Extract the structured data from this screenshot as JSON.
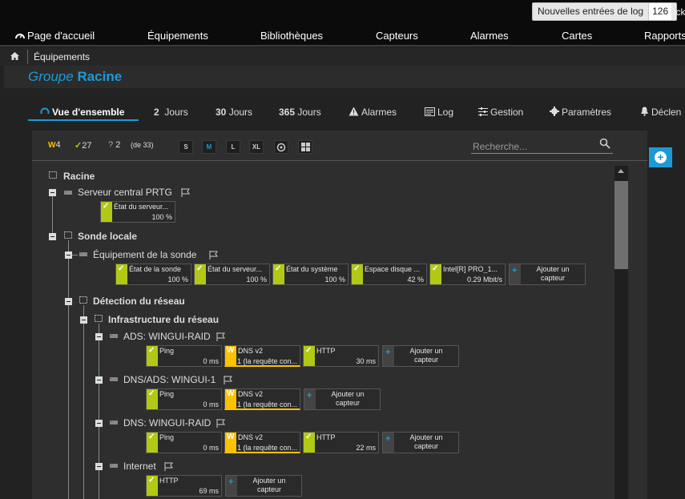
{
  "topbar": {
    "log_label": "Nouvelles entrées de log",
    "log_count": "126",
    "ticket_label": "Tick"
  },
  "nav": [
    "Page d'accueil",
    "Équipements",
    "Bibliothèques",
    "Capteurs",
    "Alarmes",
    "Cartes",
    "Rapports"
  ],
  "breadcrumb": {
    "current": "Équipements"
  },
  "page": {
    "title_prefix": "Groupe",
    "title_name": "Racine"
  },
  "tabs": {
    "overview": "Vue d'ensemble",
    "t2_num": "2",
    "t2_lbl": "Jours",
    "t30_num": "30",
    "t30_lbl": "Jours",
    "t365_num": "365",
    "t365_lbl": "Jours",
    "alarms": "Alarmes",
    "log": "Log",
    "manage": "Gestion",
    "settings": "Paramètres",
    "triggers": "Déclen"
  },
  "toolbar": {
    "warn_count": "4",
    "ok_count": "27",
    "unknown_count": "2",
    "total": "(de 33)",
    "sizes": [
      "S",
      "M",
      "L",
      "XL"
    ],
    "active_size": "M",
    "search_placeholder": "Recherche..."
  },
  "tree": {
    "root": "Racine",
    "server": "Serveur central PRTG",
    "local_probe": "Sonde locale",
    "probe_device": "Équipement de la sonde",
    "network_discovery": "Détection du réseau",
    "infrastructure": "Infrastructure du réseau",
    "ads": "ADS: WINGUI-RAID",
    "dnsads": "DNS/ADS: WINGUI-1",
    "dns": "DNS: WINGUI-RAID",
    "internet": "Internet"
  },
  "sensors": {
    "server": [
      {
        "name": "État du serveur...",
        "value": "100 %",
        "status": "ok"
      }
    ],
    "probe": [
      {
        "name": "État de la sonde",
        "value": "100 %",
        "status": "ok"
      },
      {
        "name": "État du serveur...",
        "value": "100 %",
        "status": "ok"
      },
      {
        "name": "État du système",
        "value": "100 %",
        "status": "ok"
      },
      {
        "name": "Espace disque ...",
        "value": "42 %",
        "status": "ok"
      },
      {
        "name": "Intel[R] PRO_1...",
        "value": "0.29 Mbit/s",
        "status": "ok"
      }
    ],
    "ads": [
      {
        "name": "Ping",
        "value": "0 ms",
        "status": "ok"
      },
      {
        "name": "DNS v2",
        "value": "1 (la requête con...",
        "status": "warn"
      },
      {
        "name": "HTTP",
        "value": "30 ms",
        "status": "ok"
      }
    ],
    "dnsads": [
      {
        "name": "Ping",
        "value": "0 ms",
        "status": "ok"
      },
      {
        "name": "DNS v2",
        "value": "1 (la requête con...",
        "status": "warn"
      }
    ],
    "dns": [
      {
        "name": "Ping",
        "value": "0 ms",
        "status": "ok"
      },
      {
        "name": "DNS v2",
        "value": "1 (la requête con...",
        "status": "warn"
      },
      {
        "name": "HTTP",
        "value": "22 ms",
        "status": "ok"
      }
    ],
    "internet": [
      {
        "name": "HTTP",
        "value": "69 ms",
        "status": "ok"
      }
    ],
    "add_label_1": "Ajouter un",
    "add_label_2": "capteur"
  },
  "colors": {
    "accent": "#1c9ad6",
    "ok": "#b3c814",
    "warn": "#fcc200"
  }
}
